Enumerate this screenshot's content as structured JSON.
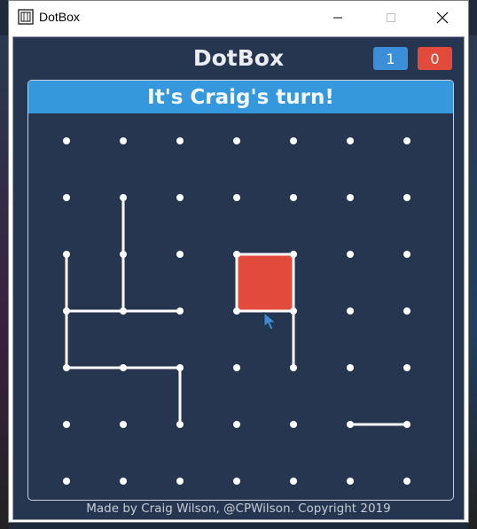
{
  "window": {
    "title": "DotBox",
    "app_icon": "dotbox-app-icon",
    "controls": [
      "minimize-icon",
      "maximize-icon",
      "close-icon"
    ]
  },
  "game": {
    "title": "DotBox",
    "scores": [
      {
        "player": "blue",
        "value": "1",
        "color": "#3b8fd9"
      },
      {
        "player": "red",
        "value": "0",
        "color": "#e24a3b"
      }
    ],
    "turn_message": "It's Craig's turn!",
    "footer": "Made by Craig Wilson, @CPWilson. Copyright 2019"
  },
  "board": {
    "cols": 7,
    "rows": 7,
    "dot_color": "#ffffff",
    "line_color": "#ffffff",
    "lines": [
      [
        [
          1,
          1
        ],
        [
          1,
          2
        ]
      ],
      [
        [
          1,
          2
        ],
        [
          1,
          3
        ]
      ],
      [
        [
          0,
          2
        ],
        [
          0,
          3
        ]
      ],
      [
        [
          0,
          3
        ],
        [
          0,
          4
        ]
      ],
      [
        [
          0,
          3
        ],
        [
          1,
          3
        ]
      ],
      [
        [
          1,
          3
        ],
        [
          2,
          3
        ]
      ],
      [
        [
          0,
          4
        ],
        [
          1,
          4
        ]
      ],
      [
        [
          1,
          4
        ],
        [
          2,
          4
        ]
      ],
      [
        [
          2,
          4
        ],
        [
          2,
          5
        ]
      ],
      [
        [
          3,
          2
        ],
        [
          4,
          2
        ]
      ],
      [
        [
          3,
          2
        ],
        [
          3,
          3
        ]
      ],
      [
        [
          4,
          2
        ],
        [
          4,
          3
        ]
      ],
      [
        [
          3,
          3
        ],
        [
          4,
          3
        ]
      ],
      [
        [
          4,
          3
        ],
        [
          4,
          4
        ]
      ],
      [
        [
          5,
          5
        ],
        [
          6,
          5
        ]
      ]
    ],
    "boxes": [
      {
        "col": 3,
        "row": 2,
        "owner": "red",
        "color": "#e24a3b"
      }
    ]
  }
}
